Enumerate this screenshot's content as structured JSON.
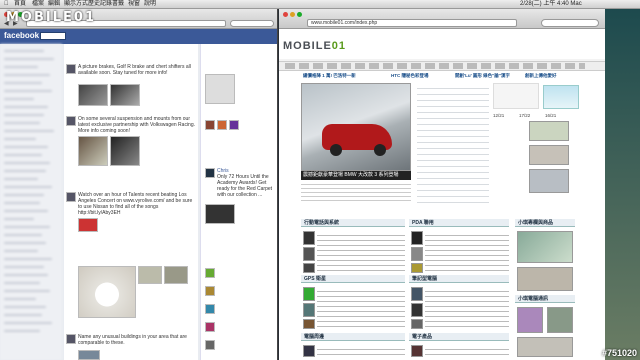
{
  "menubar": {
    "items": [
      "首頁",
      "檔案",
      "編輯",
      "顯示方式",
      "歷史記錄",
      "書籤",
      "視窗",
      "說明"
    ],
    "status": "2/28(二) 上午 4:40 Mac"
  },
  "overlay_logo": {
    "text": "MOBILE",
    "suffix": "01"
  },
  "watermark": "#751020",
  "left_window": {
    "facebook": {
      "logo": "facebook",
      "posts": [
        {
          "text": "A picture brakes, Golf R brake and chert shifters all available soon. Stay tuned for more info!"
        },
        {
          "text": "On some several suspension and mounts from our latest exclusive partnership with Volkswagen Racing. More info coming soon!"
        },
        {
          "text": "Watch over an hour of Talents recent beating Los Angeles Concert on www.vyrolive.com/ and be sure to use Nissan to find all of the songs http://bit.ly/Aby3EH"
        },
        {
          "text": "Name any unusual buildings in your area that are comparable to these."
        }
      ],
      "right": {
        "text1": "Chris",
        "text2": "Only 72 Hours Until the Academy Awards! Get ready for the Red Carpet with our collection ..."
      }
    }
  },
  "right_window": {
    "url": "www.mobile01.com/index.php",
    "site": {
      "logo_text": "MOBILE",
      "logo_suffix": "01",
      "headline_left": "總價格降 1 萬! 巴洛特一新",
      "headline_mid": "HTC 隱秘色彩登場",
      "headline_right": "開創'Lu' 圓形 綠色\"論\"漢字",
      "headline_far": "創新上傳他愛好",
      "feature_caption": "震撼鉅獻豪華登場 BMW 大改款 3 系列登場",
      "sections": [
        "行動電話與系統",
        "PDA 聯用",
        "電子產品",
        "GPS 衛星",
        "電腦周邊",
        "筆記型電腦"
      ],
      "side_title": "小琪電腦通訊",
      "side_title2": "小琪專欄與商品",
      "day_label": "週",
      "temps": [
        "12/21",
        "17/22",
        "16/21"
      ]
    }
  }
}
